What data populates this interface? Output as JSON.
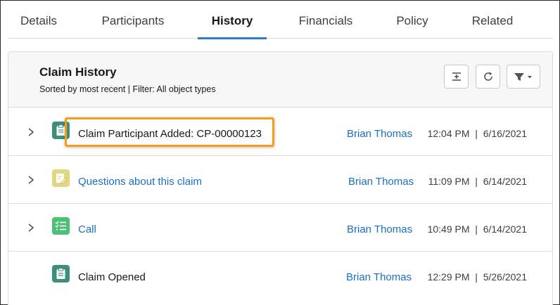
{
  "tabs": [
    {
      "label": "Details",
      "active": false
    },
    {
      "label": "Participants",
      "active": false
    },
    {
      "label": "History",
      "active": true
    },
    {
      "label": "Financials",
      "active": false
    },
    {
      "label": "Policy",
      "active": false
    },
    {
      "label": "Related",
      "active": false
    }
  ],
  "card": {
    "title": "Claim History",
    "subtitle": "Sorted by most recent | Filter: All object types"
  },
  "rows": [
    {
      "title": "Claim Participant Added: CP-00000123",
      "title_is_link": false,
      "user": "Brian Thomas",
      "time": "12:04 PM  |  6/16/2021",
      "expandable": true,
      "icon": "clipboard-icon",
      "icon_color": "#3e8e7e"
    },
    {
      "title": "Questions about this claim",
      "title_is_link": true,
      "user": "Brian Thomas",
      "time": "11:09 PM  |  6/14/2021",
      "expandable": true,
      "icon": "note-edit-icon",
      "icon_color": "#e3d680"
    },
    {
      "title": "Call",
      "title_is_link": true,
      "user": "Brian Thomas",
      "time": "10:49 PM  |  6/14/2021",
      "expandable": true,
      "icon": "task-list-icon",
      "icon_color": "#4bc076"
    },
    {
      "title": "Claim Opened",
      "title_is_link": false,
      "user": "Brian Thomas",
      "time": "12:29 PM  |  5/26/2021",
      "expandable": false,
      "icon": "clipboard-icon",
      "icon_color": "#3e8e7e"
    }
  ],
  "colors": {
    "accent": "#2e7ad1",
    "link": "#1b6fc2",
    "highlight": "#f39c1e"
  }
}
